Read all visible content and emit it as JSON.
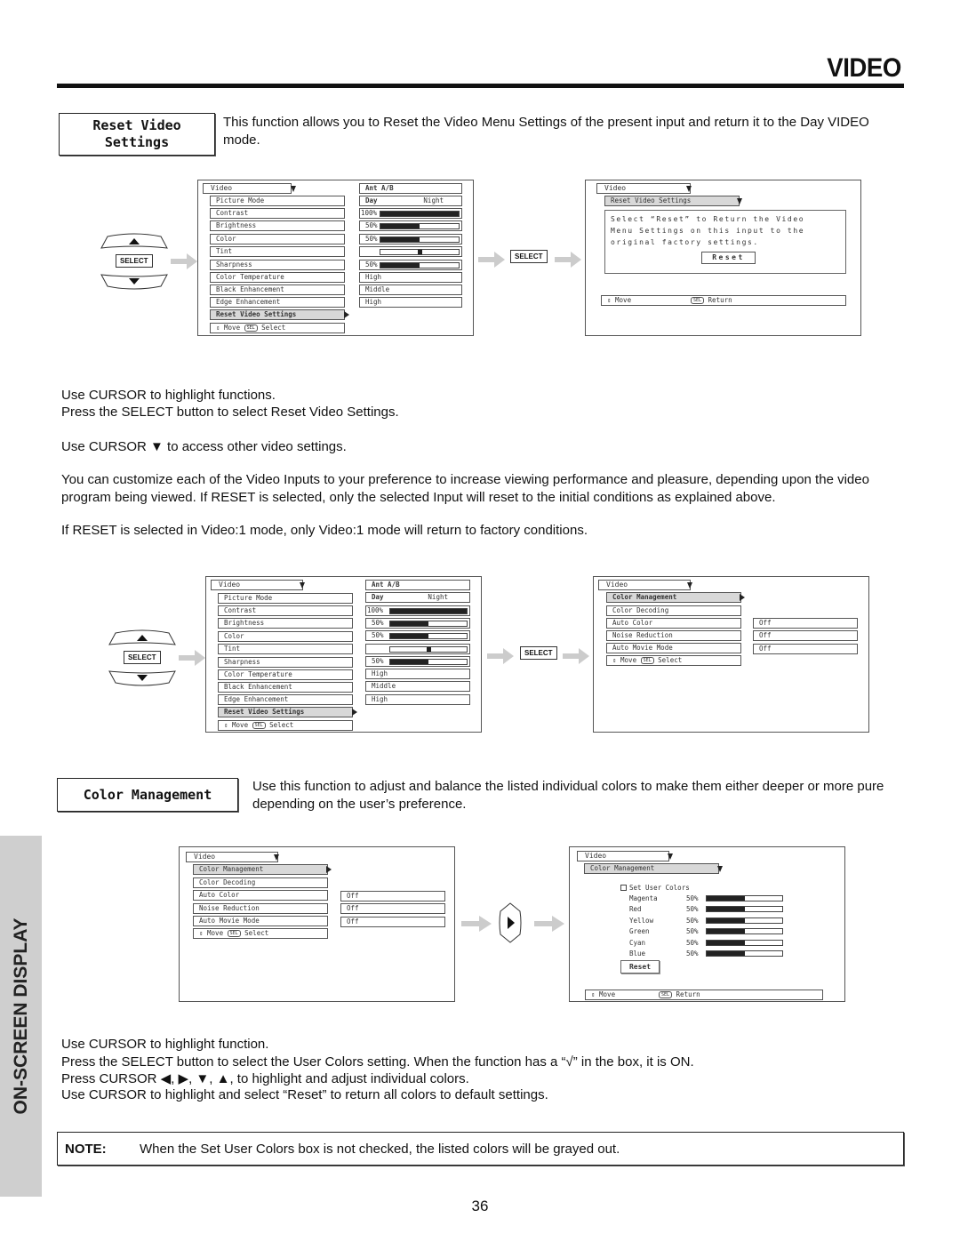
{
  "page": {
    "title": "VIDEO",
    "side_tab": "ON-SCREEN DISPLAY",
    "page_number": "36"
  },
  "reset_section": {
    "heading_line1": "Reset Video",
    "heading_line2": "Settings",
    "description": "This function allows you to Reset the Video Menu Settings of the present input and return it to the Day VIDEO mode.",
    "instructions": [
      "Use CURSOR to highlight functions.",
      "Press the SELECT button to select Reset Video Settings."
    ],
    "cursor_note": "Use CURSOR ▼ to access other video settings.",
    "customize_para": "You can customize each of the Video Inputs to your preference to increase viewing performance and pleasure, depending upon the video program being viewed. If RESET is selected, only the selected Input will reset to the initial conditions as explained above.",
    "video1_para": "If RESET is selected in Video:1 mode, only Video:1 mode will return to factory conditions."
  },
  "video_menu": {
    "title": "Video",
    "items": [
      "Picture Mode",
      "Contrast",
      "Brightness",
      "Color",
      "Tint",
      "Sharpness",
      "Color Temperature",
      "Black Enhancement",
      "Edge Enhancement",
      "Reset Video Settings"
    ],
    "ant_label": "Ant A/B",
    "picture_mode": {
      "left": "Day",
      "right": "Night"
    },
    "contrast": {
      "label": "100%",
      "value": 100
    },
    "brightness": {
      "label": "50%",
      "value": 50
    },
    "color": {
      "label": "50%",
      "value": 50
    },
    "tint": {
      "value": 50
    },
    "sharpness": {
      "label": "50%",
      "value": 50
    },
    "color_temperature": "High",
    "black_enhancement": "Middle",
    "edge_enhancement": "High",
    "footer": {
      "move": "Move",
      "sel": "SEL",
      "action": "Select"
    }
  },
  "reset_menu": {
    "title": "Video",
    "submenu": "Reset Video Settings",
    "message_lines": [
      "Select “Reset” to Return the Video",
      "Menu Settings on this input to the",
      "original factory settings."
    ],
    "reset_button": "Reset",
    "footer": {
      "move": "Move",
      "sel": "SEL",
      "action": "Return"
    }
  },
  "remote": {
    "up_icon": "up-arrow-icon",
    "down_icon": "down-arrow-icon",
    "select_label": "SELECT"
  },
  "color_mgmt_menu": {
    "title": "Video",
    "items": [
      "Color Management",
      "Color Decoding",
      "Auto Color",
      "Noise Reduction",
      "Auto Movie Mode"
    ],
    "values": {
      "auto_color": "Off",
      "noise_reduction": "Off",
      "auto_movie_mode": "Off"
    },
    "footer": {
      "move": "Move",
      "sel": "SEL",
      "action": "Select"
    }
  },
  "color_section": {
    "heading": "Color Management",
    "description": "Use this function to adjust and balance the listed individual colors to make them either deeper or more pure depending on the user’s preference.",
    "instructions": [
      "Use CURSOR to highlight function.",
      "Press the SELECT button to select the User Colors setting.  When the function has a “√” in the box, it is ON.",
      "Press CURSOR ◀, ▶, ▼, ▲, to highlight and adjust individual colors.",
      "Use CURSOR to highlight and select “Reset” to return all colors to default settings."
    ]
  },
  "user_colors_menu": {
    "title": "Video",
    "submenu": "Color Management",
    "checkbox_label": "Set User Colors",
    "checked": false,
    "colors": [
      {
        "name": "Magenta",
        "label": "50%",
        "value": 50
      },
      {
        "name": "Red",
        "label": "50%",
        "value": 50
      },
      {
        "name": "Yellow",
        "label": "50%",
        "value": 50
      },
      {
        "name": "Green",
        "label": "50%",
        "value": 50
      },
      {
        "name": "Cyan",
        "label": "50%",
        "value": 50
      },
      {
        "name": "Blue",
        "label": "50%",
        "value": 50
      }
    ],
    "reset_button": "Reset",
    "footer": {
      "move": "Move",
      "sel": "SEL",
      "action": "Return"
    }
  },
  "note": {
    "label": "NOTE:",
    "text": "When the Set User Colors box is not checked, the listed colors will be grayed out."
  }
}
